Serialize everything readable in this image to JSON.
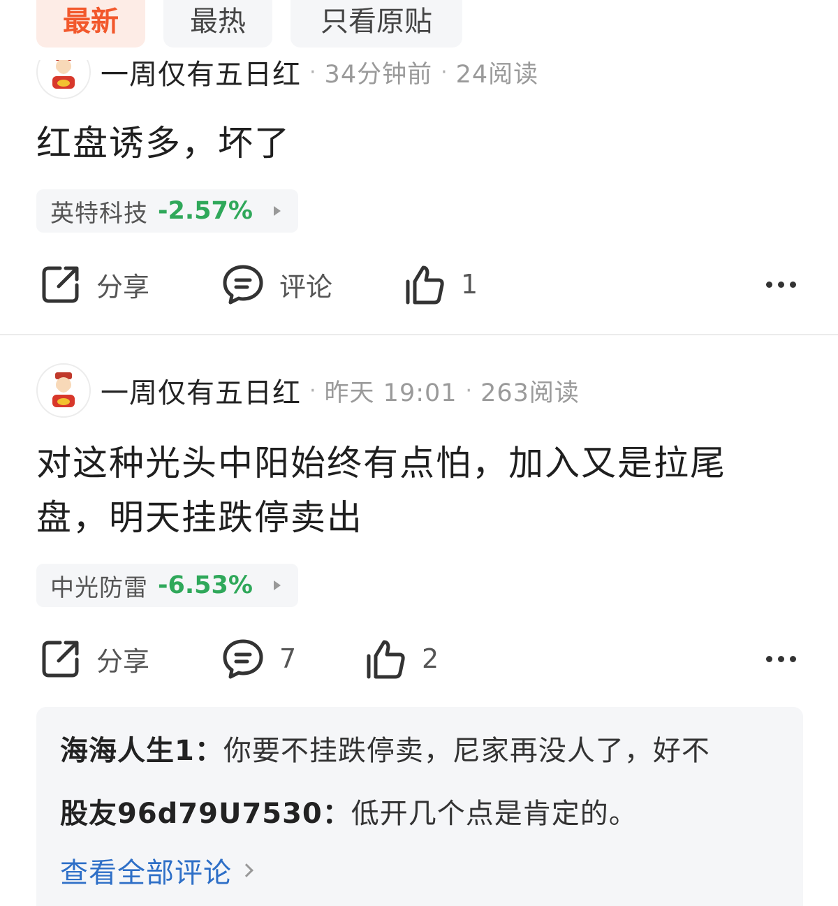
{
  "tabs": [
    {
      "label": "最新",
      "active": true
    },
    {
      "label": "最热",
      "active": false
    },
    {
      "label": "只看原贴",
      "active": false
    }
  ],
  "posts": [
    {
      "username": "一周仅有五日红",
      "time": "34分钟前",
      "reads": "24阅读",
      "text": "红盘诱多，坏了",
      "stock": {
        "name": "英特科技",
        "change": "-2.57%"
      },
      "actions": {
        "share": "分享",
        "comment": "评论",
        "like": "1"
      }
    },
    {
      "username": "一周仅有五日红",
      "time": "昨天 19:01",
      "reads": "263阅读",
      "text_line1": "对这种光头中阳始终有点怕，加入又是拉尾",
      "text_line2": "盘，明天挂跌停卖出",
      "stock": {
        "name": "中光防雷",
        "change": "-6.53%"
      },
      "actions": {
        "share": "分享",
        "comment": "7",
        "like": "2"
      },
      "comments": [
        {
          "author": "海海人生1：",
          "text": "你要不挂跌停卖，尼家再没人了，好不"
        },
        {
          "author": "股友96d79U7530：",
          "text": "低开几个点是肯定的。"
        }
      ],
      "view_all": "查看全部评论"
    }
  ],
  "colors": {
    "accent": "#f2582c",
    "down": "#2fa85a",
    "link": "#2e6fc7"
  }
}
